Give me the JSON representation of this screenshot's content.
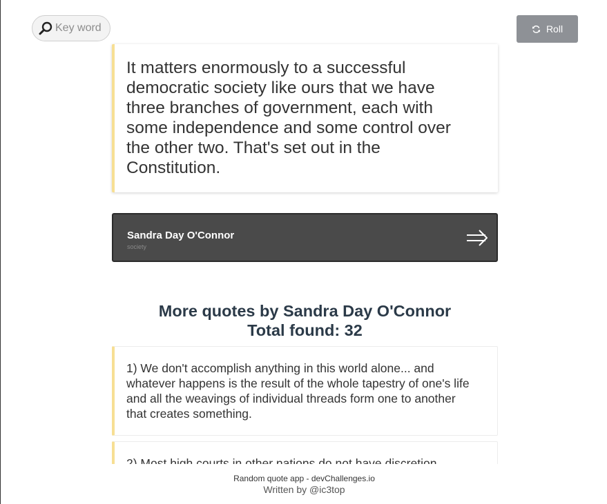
{
  "search": {
    "placeholder": "Key word",
    "icon": "magnifier-icon"
  },
  "roll_button": {
    "label": "Roll",
    "icon": "refresh-icon",
    "color": "#8e9196"
  },
  "main_quote": {
    "text": "It matters enormously to a successful democratic society like ours that we have three branches of government, each with some independence and some control over the other two. That's set out in the Constitution.",
    "accent": "#f7df94"
  },
  "author_card": {
    "name": "Sandra Day O'Connor",
    "genre": "society",
    "icon": "arrow-right-icon",
    "background": "#4a4a4a"
  },
  "more_quotes": {
    "heading": "More quotes by Sandra Day O'Connor",
    "total": "Total found: 32",
    "items": [
      {
        "text": "1) We don't accomplish anything in this world alone... and whatever happens is the result of the whole tapestry of one's life and all the weavings of individual threads form one to another that creates something."
      },
      {
        "text": "2) Most high courts in other nations do not have discretion"
      }
    ]
  },
  "footer": {
    "line1": "Random quote app - devChallenges.io",
    "line2": "Written by @ic3top"
  }
}
